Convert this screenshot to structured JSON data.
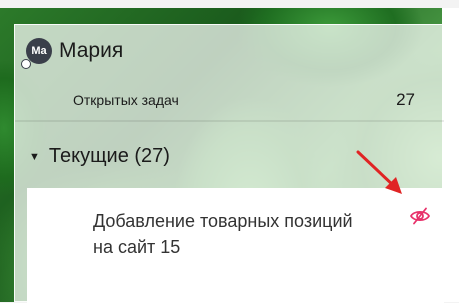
{
  "user": {
    "avatar_initials": "Ma",
    "name": "Мария",
    "open_tasks_label": "Открытых задач",
    "open_tasks_count": "27"
  },
  "section": {
    "title": "Текущие (27)",
    "caret_icon": "caret-down-icon"
  },
  "task": {
    "title": "Добавление товарных позиций на сайт 15",
    "hidden_icon": "eye-off-icon",
    "icon_color": "#e8316a"
  },
  "annotation": {
    "arrow_color": "#e02424"
  }
}
